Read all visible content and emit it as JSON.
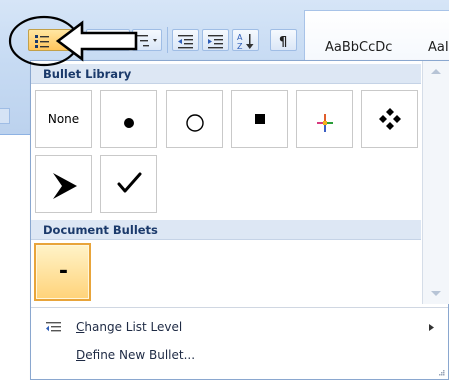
{
  "ribbon": {
    "style_previews": [
      "AaBbCcDc",
      "AaI"
    ],
    "buttons": [
      {
        "name": "bullets-button",
        "icon": "bullets-icon"
      },
      {
        "name": "numbering-button",
        "icon": "numbering-icon"
      },
      {
        "name": "multilevel-list-button",
        "icon": "multilevel-list-icon"
      },
      {
        "name": "decrease-indent-button",
        "icon": "decrease-indent-icon"
      },
      {
        "name": "increase-indent-button",
        "icon": "increase-indent-icon"
      },
      {
        "name": "sort-button",
        "icon": "sort-az-icon"
      },
      {
        "name": "show-hide-button",
        "icon": "pilcrow-icon"
      }
    ],
    "sort_label": "A",
    "sort_sublabel": "Z",
    "pilcrow": "¶"
  },
  "dropdown": {
    "bullet_library_title": "Bullet Library",
    "none_label": "None",
    "bullet_library": [
      "none",
      "filled-circle",
      "hollow-circle",
      "filled-square",
      "four-diamond-colored",
      "four-diamond-black",
      "arrowhead",
      "checkmark"
    ],
    "document_bullets_title": "Document Bullets",
    "document_bullet_symbol": "-",
    "menu": {
      "change_list_level": {
        "accel": "C",
        "rest": "hange List Level"
      },
      "define_new_bullet": {
        "accel": "D",
        "rest": "efine New Bullet..."
      }
    }
  },
  "colors": {
    "ribbon_bg": "#c7dbf3",
    "header_bg": "#dde7f4",
    "header_text": "#1b3a6b",
    "selected_border": "#e8a43a",
    "selected_fill": "#ffd37a"
  },
  "annotations": [
    "circle-highlight",
    "pointing-arrow"
  ]
}
